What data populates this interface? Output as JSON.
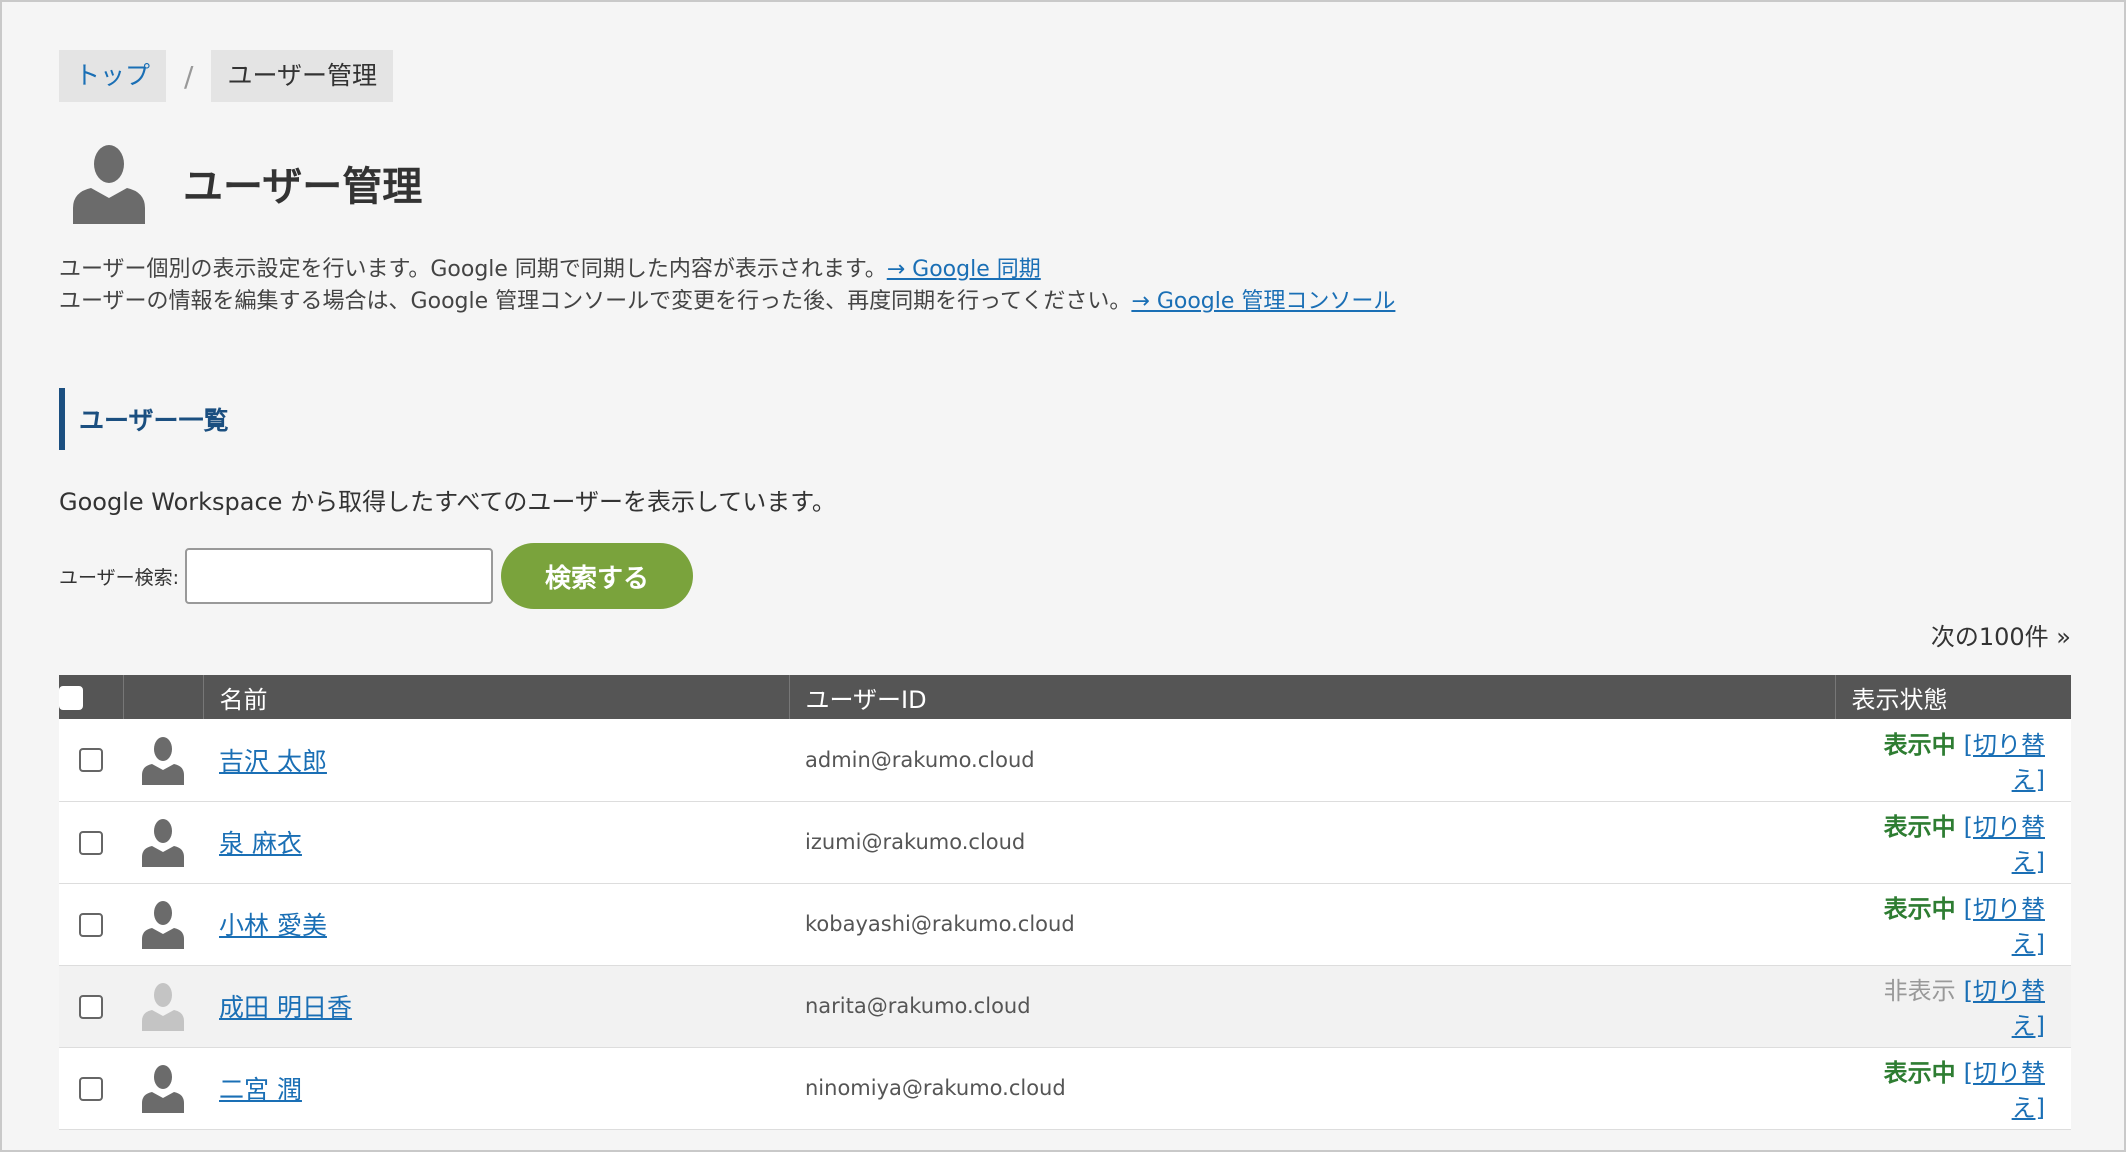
{
  "breadcrumb": {
    "top_label": "トップ",
    "separator": "/",
    "current_label": "ユーザー管理"
  },
  "page": {
    "title": "ユーザー管理",
    "intro_line1": "ユーザー個別の表示設定を行います。Google 同期で同期した内容が表示されます。",
    "intro_link1": "→ Google 同期",
    "intro_line2": "ユーザーの情報を編集する場合は、Google 管理コンソールで変更を行った後、再度同期を行ってください。",
    "intro_link2": "→ Google 管理コンソール"
  },
  "section": {
    "heading": "ユーザー一覧",
    "description": "Google Workspace から取得したすべてのユーザーを表示しています。"
  },
  "search": {
    "label": "ユーザー検索:",
    "value": "",
    "button_label": "検索する"
  },
  "pager": {
    "next_label": "次の100件 »"
  },
  "table": {
    "headers": {
      "name": "名前",
      "user_id": "ユーザーID",
      "status": "表示状態"
    },
    "rows": [
      {
        "name": "吉沢 太郎",
        "user_id": "admin@rakumo.cloud",
        "status": "表示中",
        "toggle": "[切り替え]"
      },
      {
        "name": "泉 麻衣",
        "user_id": "izumi@rakumo.cloud",
        "status": "表示中",
        "toggle": "[切り替え]"
      },
      {
        "name": "小林 愛美",
        "user_id": "kobayashi@rakumo.cloud",
        "status": "表示中",
        "toggle": "[切り替え]"
      },
      {
        "name": "成田 明日香",
        "user_id": "narita@rakumo.cloud",
        "status": "非表示",
        "toggle": "[切り替え]"
      },
      {
        "name": "二宮 潤",
        "user_id": "ninomiya@rakumo.cloud",
        "status": "表示中",
        "toggle": "[切り替え]"
      }
    ]
  },
  "colors": {
    "link": "#1a6fb5",
    "button_green": "#7aa33c",
    "status_shown": "#2e7d32",
    "status_hidden": "#999999",
    "table_header": "#555555",
    "section_accent": "#1b4f80"
  },
  "icons": {
    "page_icon": "user-silhouette-icon",
    "avatar_icon": "user-avatar-icon"
  }
}
